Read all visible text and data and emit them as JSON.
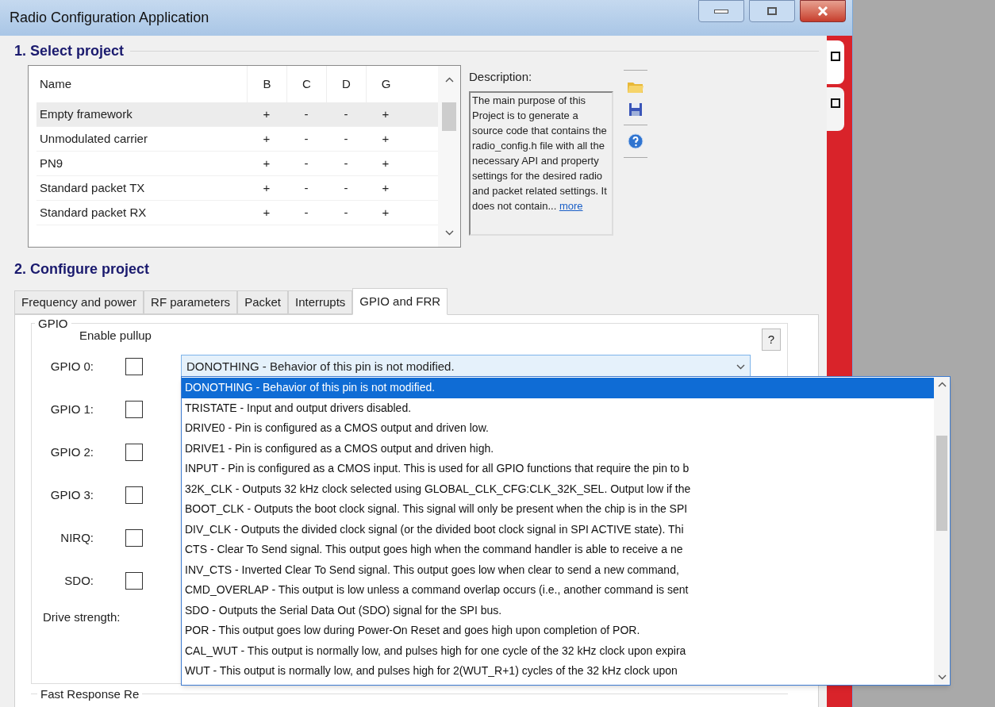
{
  "window": {
    "title": "Radio Configuration Application"
  },
  "section1": {
    "title": "1. Select project",
    "table": {
      "columns": [
        "Name",
        "B",
        "C",
        "D",
        "G"
      ],
      "rows": [
        {
          "cells": [
            "Empty framework",
            "+",
            "-",
            "-",
            "+"
          ],
          "selected": true
        },
        {
          "cells": [
            "Unmodulated carrier",
            "+",
            "-",
            "-",
            "+"
          ],
          "selected": false
        },
        {
          "cells": [
            "PN9",
            "+",
            "-",
            "-",
            "+"
          ],
          "selected": false
        },
        {
          "cells": [
            "Standard packet TX",
            "+",
            "-",
            "-",
            "+"
          ],
          "selected": false
        },
        {
          "cells": [
            "Standard packet RX",
            "+",
            "-",
            "-",
            "+"
          ],
          "selected": false
        }
      ]
    },
    "description": {
      "label": "Description:",
      "text": "The main purpose of this Project is to generate a source code that contains the radio_config.h file with all the necessary API and property settings for the desired radio and packet related settings. It does not contain...",
      "link": "more"
    }
  },
  "section2": {
    "title": "2. Configure project",
    "tabs": [
      {
        "label": "Frequency and power",
        "selected": false
      },
      {
        "label": "RF parameters",
        "selected": false
      },
      {
        "label": "Packet",
        "selected": false
      },
      {
        "label": "Interrupts",
        "selected": false
      },
      {
        "label": "GPIO and FRR",
        "selected": true
      }
    ],
    "gpio": {
      "title": "GPIO",
      "help": "?",
      "pullup_label": "Enable pullup",
      "pins": [
        {
          "label": "GPIO 0:",
          "checked": false
        },
        {
          "label": "GPIO 1:",
          "checked": false
        },
        {
          "label": "GPIO 2:",
          "checked": false
        },
        {
          "label": "GPIO 3:",
          "checked": false
        },
        {
          "label": "NIRQ:",
          "checked": false
        },
        {
          "label": "SDO:",
          "checked": false
        }
      ],
      "drive_strength_label": "Drive strength:",
      "dropdown": {
        "value": "DONOTHING - Behavior of this pin is not modified.",
        "options": [
          {
            "label": "DONOTHING - Behavior of this pin is not modified.",
            "selected": true
          },
          {
            "label": "TRISTATE - Input and output drivers disabled.",
            "selected": false
          },
          {
            "label": "DRIVE0 - Pin is configured as a CMOS output and driven low.",
            "selected": false
          },
          {
            "label": "DRIVE1 - Pin is configured as a CMOS output and driven high.",
            "selected": false
          },
          {
            "label": "INPUT - Pin is configured as a CMOS input. This is used for all GPIO functions that require the pin to b",
            "selected": false
          },
          {
            "label": "32K_CLK - Outputs 32 kHz clock selected using GLOBAL_CLK_CFG:CLK_32K_SEL. Output low if the",
            "selected": false
          },
          {
            "label": "BOOT_CLK - Outputs the boot clock signal. This signal will only be present when the chip is in the SPI",
            "selected": false
          },
          {
            "label": "DIV_CLK - Outputs the divided clock signal (or the divided boot clock signal in SPI ACTIVE state). Thi",
            "selected": false
          },
          {
            "label": "CTS - Clear To Send signal. This output goes high when the command handler is able to receive a ne",
            "selected": false
          },
          {
            "label": "INV_CTS - Inverted Clear To Send signal. This output goes low when clear to send a new command,",
            "selected": false
          },
          {
            "label": "CMD_OVERLAP - This output is low unless a command overlap occurs (i.e., another command is sent",
            "selected": false
          },
          {
            "label": "SDO - Outputs the Serial Data Out (SDO) signal for the SPI bus.",
            "selected": false
          },
          {
            "label": "POR - This output goes low during Power-On Reset and goes high upon completion of POR.",
            "selected": false
          },
          {
            "label": "CAL_WUT - This output is normally low, and pulses high for one cycle of the 32 kHz clock upon expira",
            "selected": false
          },
          {
            "label": "WUT - This output is normally low, and pulses high for 2(WUT_R+1) cycles of the 32 kHz clock upon",
            "selected": false
          }
        ]
      }
    },
    "frr": {
      "title": "Fast Response Re"
    }
  }
}
